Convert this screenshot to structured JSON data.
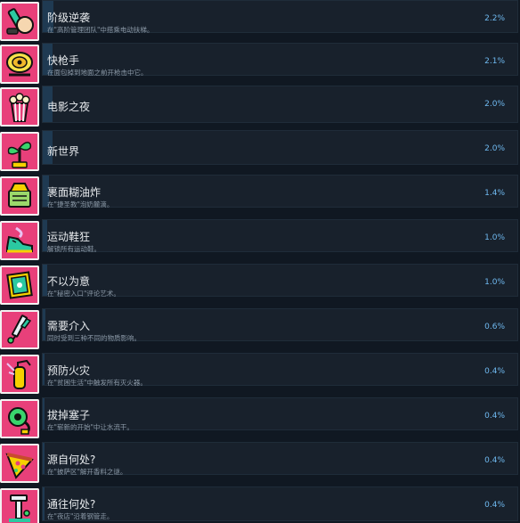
{
  "theme": {
    "icon_bg": "#e8407a",
    "panel_bg": "#18212c",
    "progress_fill": "#1f3a52",
    "percent_text": "#6fb9f0"
  },
  "achievements": [
    {
      "title": "阶级逆袭",
      "desc": "在\"高阶管理团队\"中搭乘电动扶梯。",
      "percent": "2.2%",
      "icon": "pencil-hand-icon"
    },
    {
      "title": "快枪手",
      "desc": "在面包掉到地面之前开枪击中它。",
      "percent": "2.1%",
      "icon": "bread-target-icon"
    },
    {
      "title": "电影之夜",
      "desc": "",
      "percent": "2.0%",
      "icon": "popcorn-icon"
    },
    {
      "title": "新世界",
      "desc": "",
      "percent": "2.0%",
      "icon": "plant-icon"
    },
    {
      "title": "裹面糊油炸",
      "desc": "在\"捷圣教\"泡奶麓滴。",
      "percent": "1.4%",
      "icon": "fryer-icon"
    },
    {
      "title": "运动鞋狂",
      "desc": "解锁所有运动鞋。",
      "percent": "1.0%",
      "icon": "sneaker-icon"
    },
    {
      "title": "不以为意",
      "desc": "在\"秘密入口\"评论艺术。",
      "percent": "1.0%",
      "icon": "frame-icon"
    },
    {
      "title": "需要介入",
      "desc": "同时受到三种不同的物质影响。",
      "percent": "0.6%",
      "icon": "syringe-icon"
    },
    {
      "title": "预防火灾",
      "desc": "在\"贫困生活\"中触发所有灭火器。",
      "percent": "0.4%",
      "icon": "extinguisher-icon"
    },
    {
      "title": "拔掉塞子",
      "desc": "在\"崭新的开始\"中让水流干。",
      "percent": "0.4%",
      "icon": "plug-icon"
    },
    {
      "title": "源自何处?",
      "desc": "在\"披萨区\"解开香料之谜。",
      "percent": "0.4%",
      "icon": "pizza-icon"
    },
    {
      "title": "通往何处?",
      "desc": "在\"夜店\"沿着钢管走。",
      "percent": "0.4%",
      "icon": "pipe-icon"
    }
  ]
}
